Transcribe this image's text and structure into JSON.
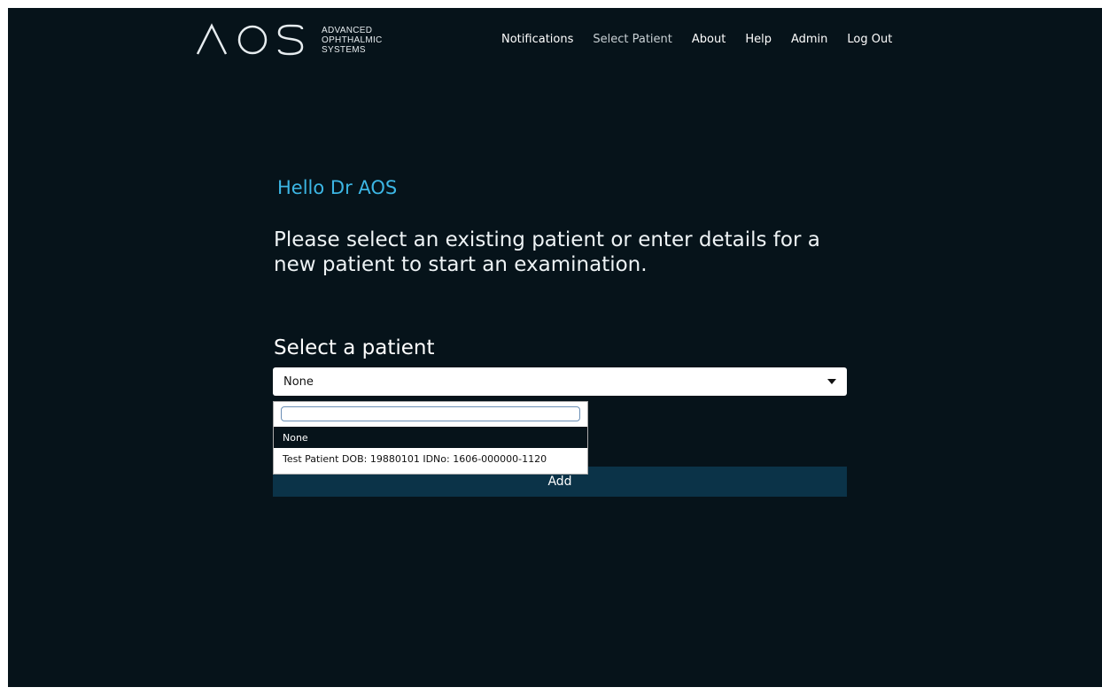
{
  "logo": {
    "text_line1": "ADVANCED",
    "text_line2": "OPHTHALMIC",
    "text_line3": "SYSTEMS"
  },
  "nav": [
    {
      "label": "Notifications",
      "active": false
    },
    {
      "label": "Select Patient",
      "active": true
    },
    {
      "label": "About",
      "active": false
    },
    {
      "label": "Help",
      "active": false
    },
    {
      "label": "Admin",
      "active": false
    },
    {
      "label": "Log Out",
      "active": false
    }
  ],
  "main": {
    "greeting": "Hello Dr AOS",
    "instructions": "Please select an existing patient or enter details for a new patient to start an examination.",
    "select_label": "Select a patient",
    "select_value": "None",
    "add_label": "Add"
  },
  "dropdown": {
    "search_value": "",
    "options": [
      "None",
      "Test Patient DOB: 19880101 IDNo: 1606-000000-1120"
    ]
  },
  "colors": {
    "background": "#06131a",
    "accent": "#3cb6e4",
    "button": "#0b3348"
  }
}
